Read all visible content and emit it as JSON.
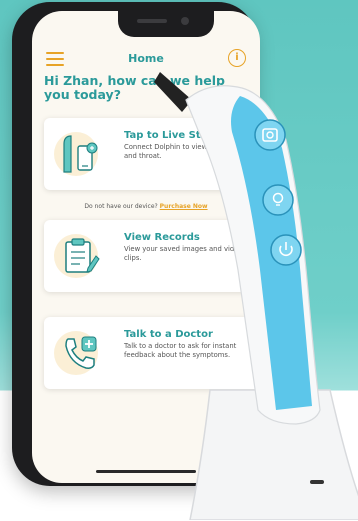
{
  "header": {
    "title": "Home"
  },
  "greeting": "Hi Zhan, how can we help you today?",
  "cards": [
    {
      "title": "Tap to Live Stream",
      "desc": "Connect Dolphin to view your nose and throat."
    },
    {
      "title": "View Records",
      "desc": "View your saved images and video clips."
    },
    {
      "title": "Talk to a Doctor",
      "desc": "Talk to a doctor to ask for instant feedback about the symptoms."
    }
  ],
  "purchase": {
    "text": "Do not have our device?",
    "link": "Purchase Now"
  },
  "colors": {
    "accent": "#2b9a9a",
    "highlight": "#e7a327",
    "device_blue": "#5cc6ea",
    "background": "#5fc6c0"
  },
  "icons": [
    "menu-icon",
    "info-icon",
    "live-stream-icon",
    "records-icon",
    "doctor-phone-icon"
  ]
}
